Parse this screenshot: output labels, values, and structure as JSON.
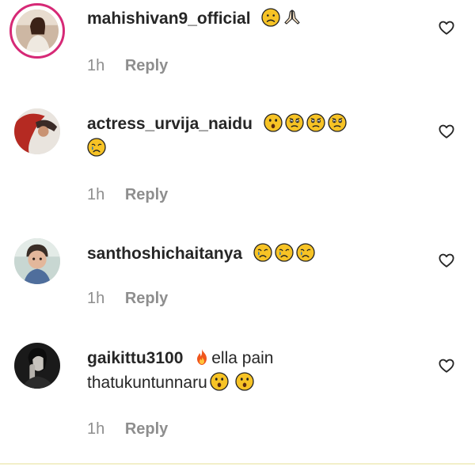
{
  "comments": [
    {
      "username": "mahishivan9_official",
      "emojis": [
        "frowning-face-emoji",
        "folded-hands-emoji"
      ],
      "time": "1h",
      "reply_label": "Reply"
    },
    {
      "username": "actress_urvija_naidu",
      "emojis": [
        "astonished-face-emoji",
        "slightly-frowning-face-emoji",
        "slightly-frowning-face-emoji",
        "slightly-frowning-face-emoji",
        "crying-face-emoji"
      ],
      "time": "1h",
      "reply_label": "Reply"
    },
    {
      "username": "santhoshichaitanya",
      "emojis": [
        "crying-face-emoji",
        "crying-face-emoji",
        "crying-face-emoji"
      ],
      "time": "1h",
      "reply_label": "Reply"
    },
    {
      "username": "gaikittu3100",
      "text_part1": "ella pain",
      "text_part2": "thatukuntunnaru",
      "emojis": [
        "fire-emoji",
        "astonished-face-emoji",
        "astonished-face-emoji"
      ],
      "time": "1h",
      "reply_label": "Reply"
    }
  ],
  "colors": {
    "story_ring": "#d62976",
    "emoji_face": "#f7c325",
    "meta_text": "#8e8e8e",
    "username_text": "#262626"
  }
}
